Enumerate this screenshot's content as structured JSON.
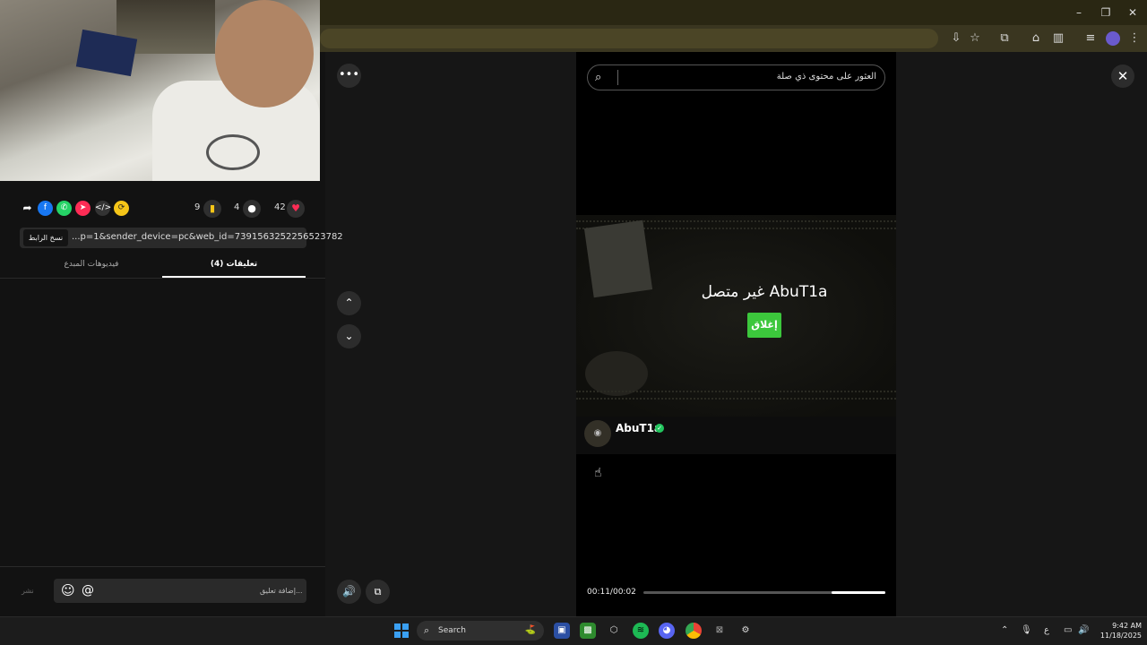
{
  "window": {
    "minimize": "–",
    "restore": "❐",
    "close": "✕"
  },
  "browser": {
    "toolbar_icons": [
      "install-icon",
      "star-icon",
      "extensions-icon",
      "labs-icon",
      "sidebar-icon",
      "media-icon",
      "profile-icon",
      "menu-icon"
    ]
  },
  "stats": {
    "likes": "42",
    "comments": "4",
    "saves": "9"
  },
  "share": {
    "link_text": "...p=1&sender_device=pc&web_id=7391563252256523782",
    "copy_label": "نسخ الرابط"
  },
  "tabs": {
    "comments": "تعليقات (4)",
    "creator_videos": "فيديوهات المبدع"
  },
  "comment": {
    "placeholder": "إضافة تعليق...",
    "post": "نشر",
    "emoji": "☺",
    "mention": "@"
  },
  "search": {
    "placeholder": "العثور على محتوى ذي صلة"
  },
  "video": {
    "offline_text": "غير متصل AbuT1a",
    "close_button": "إغلاق",
    "creator_name": "AbuT1a",
    "time": "00:11/00:02",
    "progress": 0.78
  },
  "controls": {
    "more": "•••",
    "close": "✕",
    "up": "⌃",
    "down": "⌄",
    "volume": "🔊",
    "pip": "⧉"
  },
  "taskbar": {
    "search_label": "Search",
    "time": "9:42 AM",
    "date": "11/18/2025",
    "lang": "ع"
  }
}
